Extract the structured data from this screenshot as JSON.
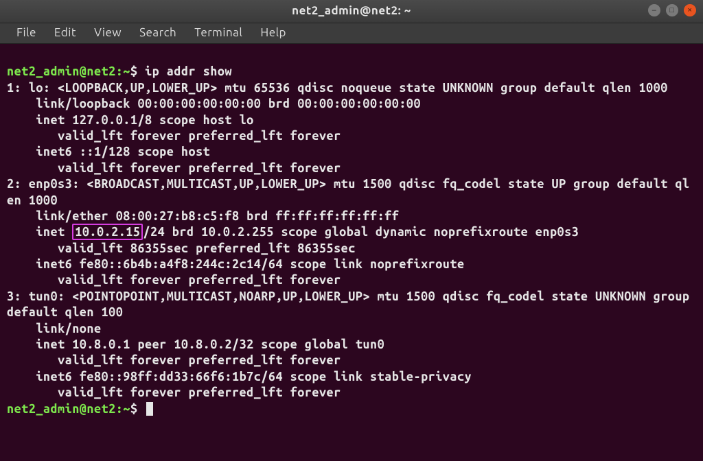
{
  "window": {
    "title": "net2_admin@net2: ~"
  },
  "menu": {
    "file": "File",
    "edit": "Edit",
    "view": "View",
    "search": "Search",
    "terminal": "Terminal",
    "help": "Help"
  },
  "prompt": {
    "userhost": "net2_admin@net2",
    "path": ":~",
    "sigil": "$"
  },
  "command": "ip addr show",
  "highlight_ip": "10.0.2.15",
  "output": {
    "l1": "1: lo: <LOOPBACK,UP,LOWER_UP> mtu 65536 qdisc noqueue state UNKNOWN group default qlen 1000",
    "l2": "    link/loopback 00:00:00:00:00:00 brd 00:00:00:00:00:00",
    "l3": "    inet 127.0.0.1/8 scope host lo",
    "l4": "       valid_lft forever preferred_lft forever",
    "l5": "    inet6 ::1/128 scope host",
    "l6": "       valid_lft forever preferred_lft forever",
    "l7": "2: enp0s3: <BROADCAST,MULTICAST,UP,LOWER_UP> mtu 1500 qdisc fq_codel state UP group default qlen 1000",
    "l8": "    link/ether 08:00:27:b8:c5:f8 brd ff:ff:ff:ff:ff:ff",
    "l9a": "    inet ",
    "l9b": "/24 brd 10.0.2.255 scope global dynamic noprefixroute enp0s3",
    "l10": "       valid_lft 86355sec preferred_lft 86355sec",
    "l11": "    inet6 fe80::6b4b:a4f8:244c:2c14/64 scope link noprefixroute",
    "l12": "       valid_lft forever preferred_lft forever",
    "l13": "3: tun0: <POINTOPOINT,MULTICAST,NOARP,UP,LOWER_UP> mtu 1500 qdisc fq_codel state UNKNOWN group default qlen 100",
    "l14": "    link/none",
    "l15": "    inet 10.8.0.1 peer 10.8.0.2/32 scope global tun0",
    "l16": "       valid_lft forever preferred_lft forever",
    "l17": "    inet6 fe80::98ff:dd33:66f6:1b7c/64 scope link stable-privacy",
    "l18": "       valid_lft forever preferred_lft forever"
  }
}
